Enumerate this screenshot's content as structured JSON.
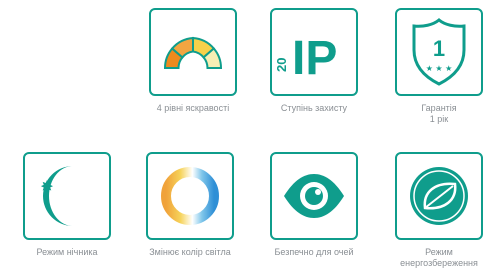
{
  "colors": {
    "accent": "#0f9d8c",
    "caption": "#8a8f94"
  },
  "features": [
    {
      "id": "brightness",
      "icon": "brightness-gauge-icon",
      "lines": [
        "4 рівні яскравості"
      ]
    },
    {
      "id": "protection",
      "icon": "ip20-icon",
      "lines": [
        "Ступінь захисту"
      ],
      "badge_main": "IP",
      "badge_side": "20"
    },
    {
      "id": "warranty",
      "icon": "warranty-shield-icon",
      "lines": [
        "Гарантія",
        "1 рік"
      ],
      "badge_number": "1"
    },
    {
      "id": "night",
      "icon": "moon-star-icon",
      "lines": [
        "Режим нічника"
      ]
    },
    {
      "id": "color",
      "icon": "color-ring-icon",
      "lines": [
        "Змінює колір світла"
      ]
    },
    {
      "id": "eyes",
      "icon": "eye-icon",
      "lines": [
        "Безпечно для очей"
      ]
    },
    {
      "id": "energy",
      "icon": "leaf-icon",
      "lines": [
        "Режим",
        "енергозбереження"
      ]
    }
  ]
}
